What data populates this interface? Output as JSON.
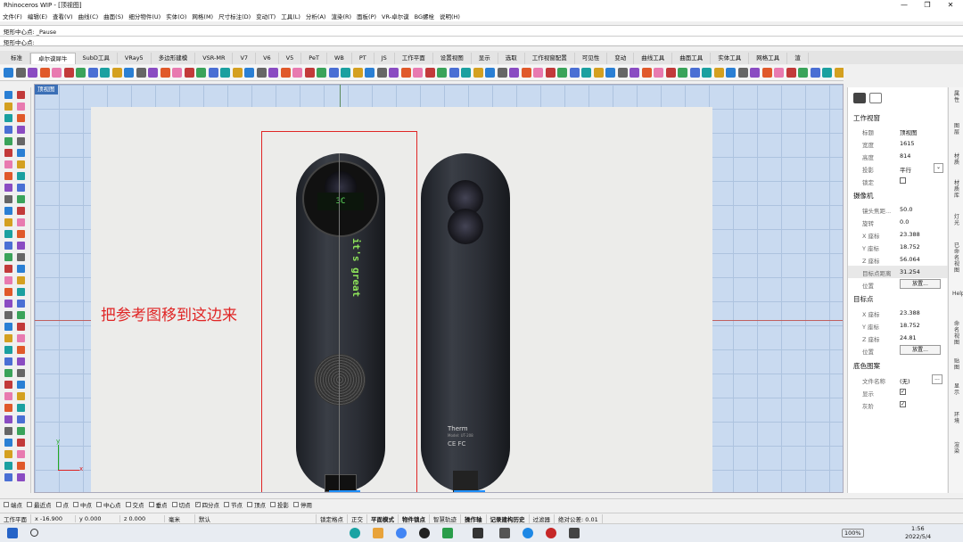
{
  "window": {
    "title": "Rhinoceros WIP - [顶视图]",
    "controls": [
      "—",
      "❐",
      "✕"
    ]
  },
  "menu": [
    "文件(F)",
    "编辑(E)",
    "查看(V)",
    "曲线(C)",
    "曲面(S)",
    "细分物件(U)",
    "实体(O)",
    "网格(M)",
    "尺寸标注(D)",
    "变动(T)",
    "工具(L)",
    "分析(A)",
    "渲染(R)",
    "面板(P)",
    "VR-卓尔谟",
    "BG螺栓",
    "说明(H)"
  ],
  "command": {
    "history": "矩形中心点: _Pause",
    "prompt": "矩形中心点:"
  },
  "tabs": [
    "标准",
    "卓尔谟犀牛",
    "SubD工具",
    "VRay5",
    "多边形建模",
    "VSR-MR",
    "V7",
    "V6",
    "V5",
    "PeT",
    "WB",
    "PT",
    "JS",
    "工作平面",
    "设置视图",
    "显示",
    "选取",
    "工作视窗配置",
    "可见性",
    "变动",
    "曲线工具",
    "曲面工具",
    "实体工具",
    "网格工具",
    "渲"
  ],
  "viewport": {
    "label": "顶视图",
    "annotation": "把参考图移到这边来",
    "axis_x": "x",
    "axis_y": "y",
    "device_text": "it's great",
    "device_brand": "Therm",
    "device_model": "Model: UT-208",
    "device_marks": "CE FC"
  },
  "panel": {
    "section_viewport": "工作视窗",
    "title_label": "标题",
    "title_value": "顶视图",
    "width_label": "宽度",
    "width_value": "1615",
    "height_label": "高度",
    "height_value": "814",
    "proj_label": "投影",
    "proj_value": "平行",
    "lock_label": "锁定",
    "section_camera": "摄像机",
    "lens_label": "镜头焦距...",
    "lens_value": "50.0",
    "rot_label": "旋转",
    "rot_value": "0.0",
    "cx_label": "X 座标",
    "cx_value": "23.388",
    "cy_label": "Y 座标",
    "cy_value": "18.752",
    "cz_label": "Z 座标",
    "cz_value": "56.064",
    "dist_label": "目标点距离",
    "dist_value": "31.254",
    "pos_label": "位置",
    "pos_btn": "放置...",
    "section_target": "目标点",
    "tx_label": "X 座标",
    "tx_value": "23.388",
    "ty_label": "Y 座标",
    "ty_value": "18.752",
    "tz_label": "Z 座标",
    "tz_value": "24.81",
    "tpos_label": "位置",
    "tpos_btn": "放置...",
    "section_bg": "底色图案",
    "file_label": "文件名称",
    "file_value": "(无)",
    "file_btn": "...",
    "show_label": "显示",
    "gray_label": "灰阶"
  },
  "vtabs": [
    "属性",
    "图层",
    "材质",
    "材质库",
    "灯光",
    "已命名视图",
    "Help",
    "命名视图",
    "贴图",
    "显示",
    "环境",
    "渲染"
  ],
  "osnap": [
    {
      "label": "端点",
      "on": false
    },
    {
      "label": "最近点",
      "on": false
    },
    {
      "label": "点",
      "on": false
    },
    {
      "label": "中点",
      "on": false
    },
    {
      "label": "中心点",
      "on": false
    },
    {
      "label": "交点",
      "on": false
    },
    {
      "label": "垂点",
      "on": false
    },
    {
      "label": "切点",
      "on": false
    },
    {
      "label": "四分点",
      "on": true
    },
    {
      "label": "节点",
      "on": false
    },
    {
      "label": "顶点",
      "on": false
    },
    {
      "label": "投影",
      "on": false
    },
    {
      "label": "停用",
      "on": false
    }
  ],
  "status": {
    "cplane": "工作平面",
    "x": "x -16.900",
    "y": "y 0.000",
    "z": "z 0.000",
    "unit": "毫米",
    "layer": "默认",
    "grid_snap": "锁定格点",
    "ortho": "正交",
    "planar": "平面模式",
    "osnap": "物件锁点",
    "smarttrack": "智慧轨迹",
    "gumball": "操作轴",
    "history": "记录建构历史",
    "filter": "过滤器",
    "tolerance": "绝对公差: 0.01"
  },
  "taskbar": {
    "battery": "100%",
    "time": "1:56",
    "date": "2022/5/4"
  }
}
